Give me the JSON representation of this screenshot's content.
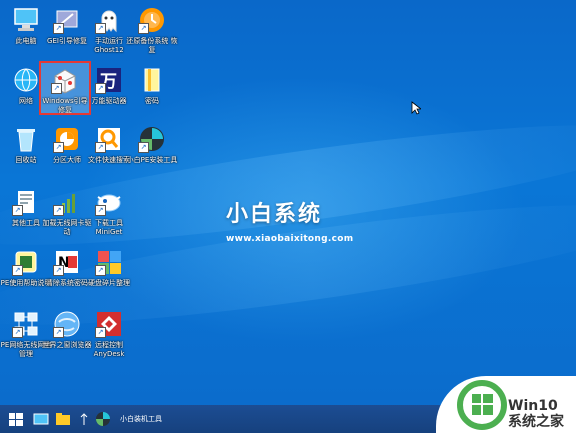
{
  "desktop": {
    "icons": [
      {
        "label": "此电脑"
      },
      {
        "label": "GEI引导修复"
      },
      {
        "label": "手动运行 Ghost12"
      },
      {
        "label": "还原备份系统 恢复"
      },
      {
        "label": "网络"
      },
      {
        "label": "Windows引导修复"
      },
      {
        "label": "万能驱动器"
      },
      {
        "label": "密码"
      },
      {
        "label": "回收站"
      },
      {
        "label": "分区大师"
      },
      {
        "label": "文件快速搜索"
      },
      {
        "label": "小白PE安装工具"
      },
      {
        "label": "其他工具"
      },
      {
        "label": "加载无线网卡驱动"
      },
      {
        "label": "下载工具 MiniGet"
      },
      {
        "label": "PE使用帮助说明"
      },
      {
        "label": "清除系统密码"
      },
      {
        "label": "硬盘碎片整理"
      },
      {
        "label": "PE网络无线网络管理"
      },
      {
        "label": "世界之窗浏览器"
      },
      {
        "label": "远程控制 AnyDesk"
      }
    ],
    "selected_icon": "Windows引导修复"
  },
  "brand": {
    "title": "小白系统",
    "url": "www.xiaobaixitong.com"
  },
  "taskbar": {
    "running_app_label": "小白装机工具"
  },
  "watermark": {
    "line1": "Win10",
    "line2": "系统之家"
  },
  "colors": {
    "desktop_blue": "#0a72d2",
    "taskbar": "#16417e",
    "selection_outline": "#e53935",
    "win10_green": "#4caf50"
  },
  "icon_names": [
    "computer-icon",
    "repair-icon",
    "ghost-icon",
    "restore-icon",
    "network-icon",
    "boot-repair-icon",
    "wanneng-driver-icon",
    "folder-icon",
    "recycle-bin-icon",
    "partition-icon",
    "file-search-icon",
    "pe-install-icon",
    "tools-icon",
    "wireless-driver-icon",
    "download-icon",
    "help-icon",
    "password-clear-icon",
    "defrag-icon",
    "network-manager-icon",
    "browser-icon",
    "remote-control-icon"
  ]
}
